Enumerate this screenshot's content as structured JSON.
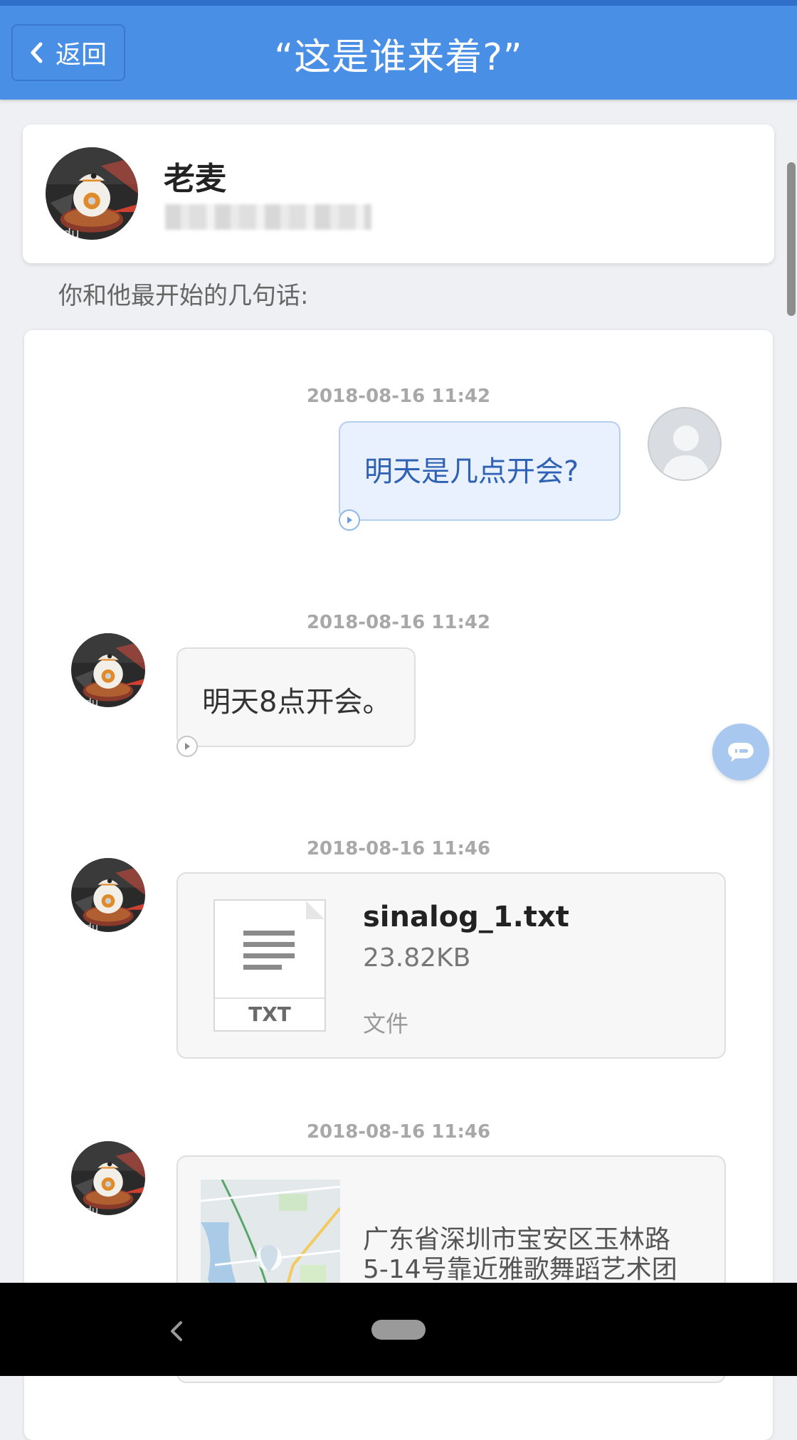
{
  "header": {
    "back_label": "返回",
    "title": "“这是谁来着?”"
  },
  "contact": {
    "name": "老麦"
  },
  "intro_text": "你和他最开始的几句话:",
  "messages": [
    {
      "timestamp": "2018-08-16 11:42",
      "sender": "me",
      "text": "明天是几点开会?"
    },
    {
      "timestamp": "2018-08-16 11:42",
      "sender": "other",
      "text": "明天8点开会。"
    },
    {
      "timestamp": "2018-08-16 11:46",
      "sender": "other",
      "file": {
        "name": "sinalog_1.txt",
        "size": "23.82KB",
        "type_label": "文件",
        "ext": "TXT"
      }
    },
    {
      "timestamp": "2018-08-16 11:46",
      "sender": "other",
      "location": {
        "line1": "广东省深圳市宝安区玉林路",
        "line2": "5-14号靠近雅歌舞蹈艺术团"
      }
    }
  ],
  "colors": {
    "header_bg": "#4a8fe6",
    "my_bubble_bg": "#e8f1fd",
    "my_bubble_text": "#2f62b4",
    "other_bubble_bg": "#f7f7f7"
  },
  "icons": [
    "chevron-left-icon",
    "play-icon",
    "default-avatar-icon",
    "document-lines-icon",
    "chat-icon",
    "nav-back-icon",
    "nav-home-pill"
  ]
}
